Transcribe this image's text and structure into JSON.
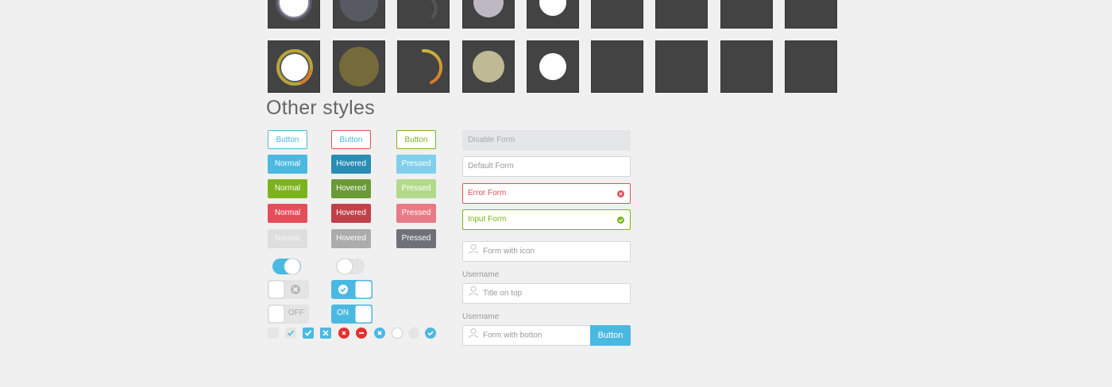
{
  "section_title": "Other styles",
  "colors": {
    "blue": "#4ab9e2",
    "blue_hover": "#2a8db5",
    "blue_pressed": "#80d0ec",
    "green": "#7cb31c",
    "green_hover": "#6a9a36",
    "green_pressed": "#b3d98a",
    "red": "#e64d5b",
    "red_hover": "#c1414b",
    "red_pressed": "#ea7a85",
    "gray_normal": "#dedede",
    "gray_hover": "#acacac",
    "gray_pressed": "#6e7178",
    "tile_bg": "#434343"
  },
  "buttons": {
    "col1": [
      "Button",
      "Normal",
      "Normal",
      "Normal",
      "Normal"
    ],
    "col2": [
      "Button",
      "Hovered",
      "Hovered",
      "Hovered",
      "Hovered"
    ],
    "col3": [
      "Button",
      "Pressed",
      "Pressed",
      "Pressed",
      "Pressed"
    ]
  },
  "toggles": {
    "off_label": "OFF",
    "on_label": "ON"
  },
  "forms": {
    "disable": "Disable Form",
    "default": "Default Form",
    "error": "Error Form",
    "input": "Input Form",
    "with_icon": "Form with icon",
    "label_1": "Username",
    "title_on_top": "Title on top",
    "label_2": "Username",
    "with_button": "Form with botton",
    "button_label": "Button"
  },
  "icons": {
    "user": "user-icon",
    "error": "error-circle-icon",
    "success": "check-circle-icon"
  }
}
